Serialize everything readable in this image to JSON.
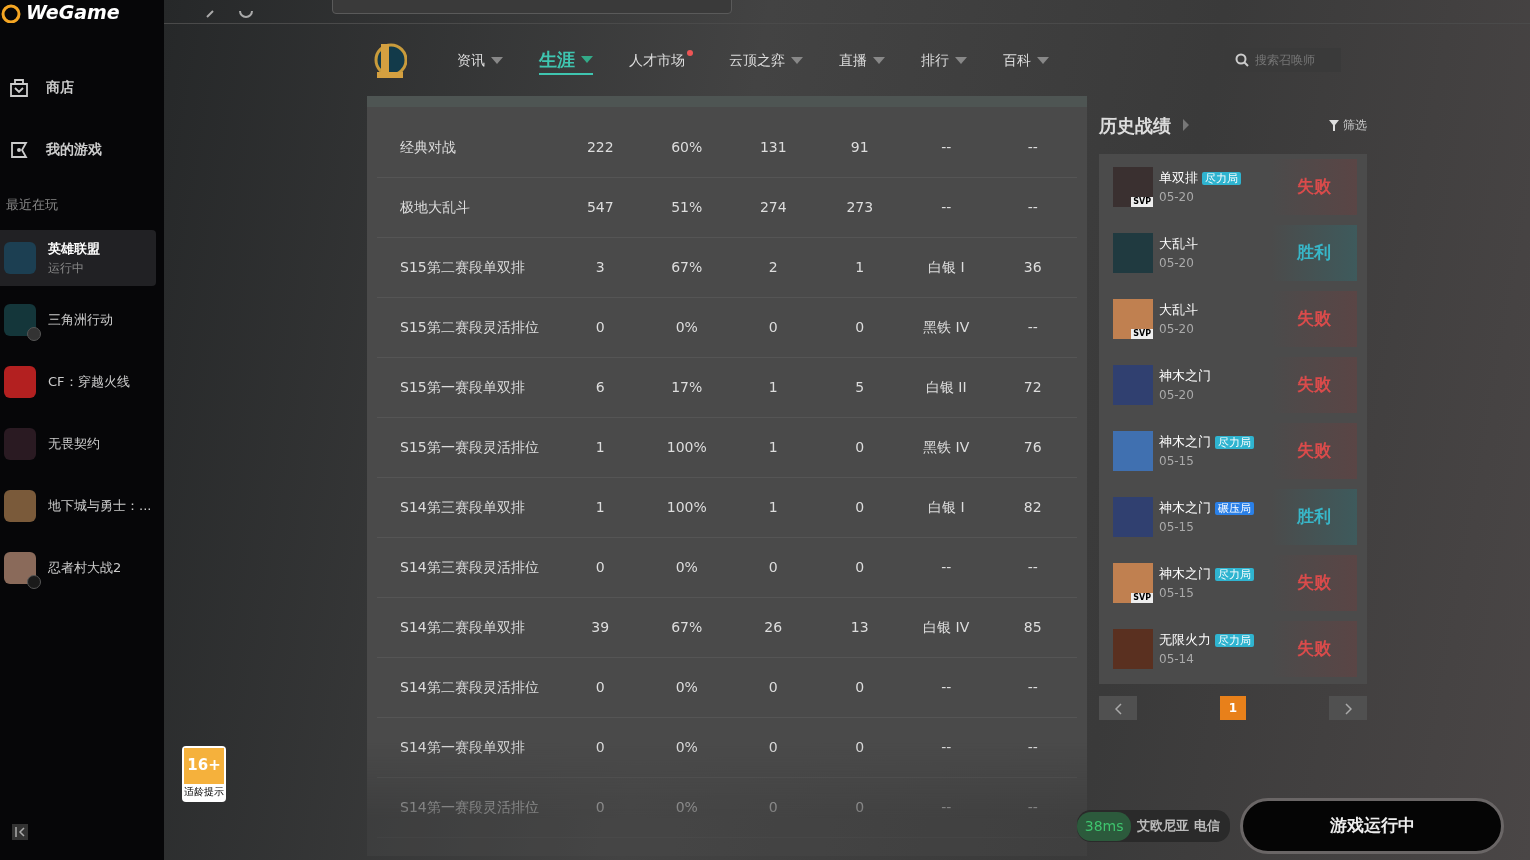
{
  "app": {
    "logo_text": "WeGame"
  },
  "sidebar": {
    "nav": [
      {
        "label": "商店",
        "kind": "store"
      },
      {
        "label": "我的游戏",
        "kind": "games"
      }
    ],
    "recent_title": "最近在玩",
    "games": [
      {
        "name": "英雄联盟",
        "status": "运行中",
        "selected": true,
        "kind": "plain"
      },
      {
        "name": "三角洲行动",
        "selected": false,
        "kind": "update"
      },
      {
        "name": "CF：穿越火线",
        "selected": false,
        "kind": "plain"
      },
      {
        "name": "无畏契约",
        "selected": false,
        "kind": "plain"
      },
      {
        "name": "地下城与勇士：...",
        "selected": false,
        "kind": "plain"
      },
      {
        "name": "忍者村大战2",
        "selected": false,
        "kind": "download"
      }
    ]
  },
  "age_rating": {
    "age": "16+",
    "caption": "适龄提示"
  },
  "tabs": [
    {
      "label": "资讯",
      "selected": false,
      "dropdown": true,
      "dot": false
    },
    {
      "label": "生涯",
      "selected": true,
      "dropdown": true,
      "dot": false
    },
    {
      "label": "人才市场",
      "selected": false,
      "dropdown": false,
      "dot": true
    },
    {
      "label": "云顶之弈",
      "selected": false,
      "dropdown": true,
      "dot": false
    },
    {
      "label": "直播",
      "selected": false,
      "dropdown": true,
      "dot": false
    },
    {
      "label": "排行",
      "selected": false,
      "dropdown": true,
      "dot": false
    },
    {
      "label": "百科",
      "selected": false,
      "dropdown": true,
      "dot": false
    }
  ],
  "summoner_search": {
    "placeholder": "搜索召唤师"
  },
  "table": {
    "rows": [
      [
        "经典对战",
        "222",
        "60%",
        "131",
        "91",
        "--",
        "--"
      ],
      [
        "极地大乱斗",
        "547",
        "51%",
        "274",
        "273",
        "--",
        "--"
      ],
      [
        "S15第二赛段单双排",
        "3",
        "67%",
        "2",
        "1",
        "白银 I",
        "36"
      ],
      [
        "S15第二赛段灵活排位",
        "0",
        "0%",
        "0",
        "0",
        "黑铁 IV",
        "--"
      ],
      [
        "S15第一赛段单双排",
        "6",
        "17%",
        "1",
        "5",
        "白银 II",
        "72"
      ],
      [
        "S15第一赛段灵活排位",
        "1",
        "100%",
        "1",
        "0",
        "黑铁 IV",
        "76"
      ],
      [
        "S14第三赛段单双排",
        "1",
        "100%",
        "1",
        "0",
        "白银 I",
        "82"
      ],
      [
        "S14第三赛段灵活排位",
        "0",
        "0%",
        "0",
        "0",
        "--",
        "--"
      ],
      [
        "S14第二赛段单双排",
        "39",
        "67%",
        "26",
        "13",
        "白银 IV",
        "85"
      ],
      [
        "S14第二赛段灵活排位",
        "0",
        "0%",
        "0",
        "0",
        "--",
        "--"
      ],
      [
        "S14第一赛段单双排",
        "0",
        "0%",
        "0",
        "0",
        "--",
        "--"
      ],
      [
        "S14第一赛段灵活排位",
        "0",
        "0%",
        "0",
        "0",
        "--",
        "--"
      ]
    ]
  },
  "history": {
    "title": "历史战绩",
    "filter": "筛选",
    "matches": [
      {
        "mode": "单双排",
        "tag": {
          "label": "尽力局",
          "kind": "effort"
        },
        "date": "05-20",
        "result": "失败",
        "kind": "loss",
        "badge": "SVP"
      },
      {
        "mode": "大乱斗",
        "date": "05-20",
        "result": "胜利",
        "kind": "win"
      },
      {
        "mode": "大乱斗",
        "date": "05-20",
        "result": "失败",
        "kind": "loss",
        "badge": "SVP"
      },
      {
        "mode": "神木之门",
        "date": "05-20",
        "result": "失败",
        "kind": "loss"
      },
      {
        "mode": "神木之门",
        "tag": {
          "label": "尽力局",
          "kind": "effort"
        },
        "date": "05-15",
        "result": "失败",
        "kind": "loss"
      },
      {
        "mode": "神木之门",
        "tag": {
          "label": "碾压局",
          "kind": "crush"
        },
        "date": "05-15",
        "result": "胜利",
        "kind": "win"
      },
      {
        "mode": "神木之门",
        "tag": {
          "label": "尽力局",
          "kind": "effort"
        },
        "date": "05-15",
        "result": "失败",
        "kind": "loss",
        "badge": "SVP"
      },
      {
        "mode": "无限火力",
        "tag": {
          "label": "尽力局",
          "kind": "effort"
        },
        "date": "05-14",
        "result": "失败",
        "kind": "loss"
      }
    ],
    "page": "1"
  },
  "status": {
    "ping": "38ms",
    "server": "艾欧尼亚 电信",
    "launch": "游戏运行中"
  }
}
